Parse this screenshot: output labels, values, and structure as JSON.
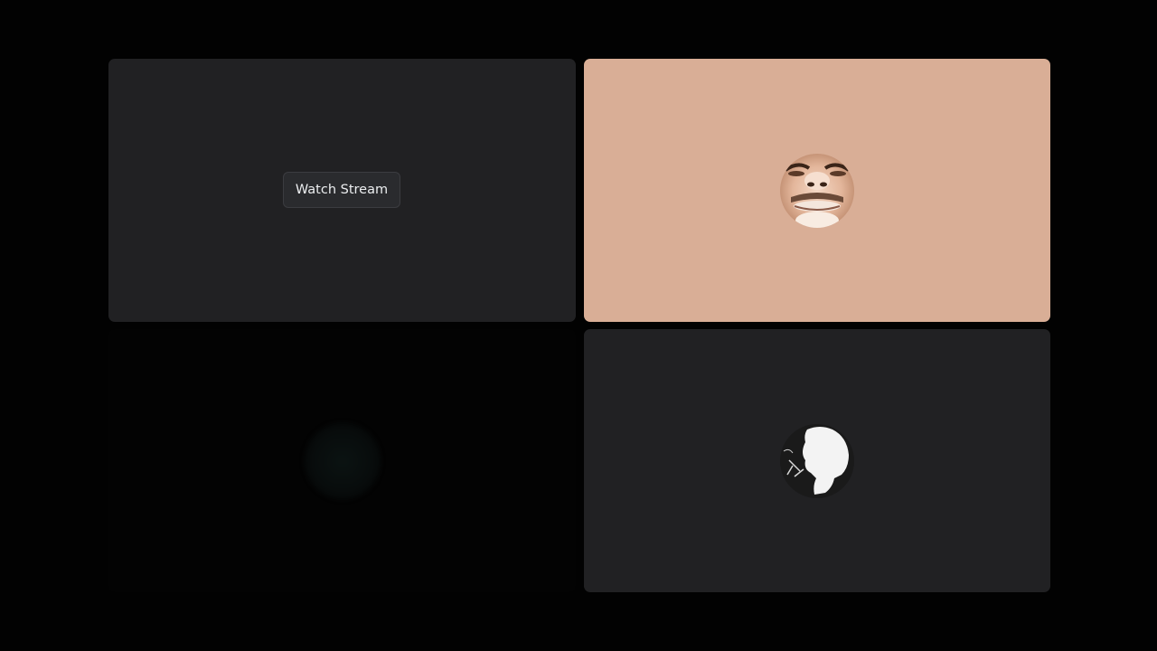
{
  "stream_tile": {
    "watch_button_label": "Watch Stream"
  },
  "participants": [
    {
      "tile_color": "#d9ae96",
      "avatar_icon": "user-avatar-face"
    },
    {
      "tile_color": "#030303",
      "avatar_icon": "user-avatar-dim"
    },
    {
      "tile_color": "#212123",
      "avatar_icon": "user-avatar-silhouette"
    }
  ],
  "colors": {
    "background": "#020202",
    "tile_dark": "#212123",
    "button_bg": "#2a2b2e",
    "button_text": "#eceef0"
  }
}
